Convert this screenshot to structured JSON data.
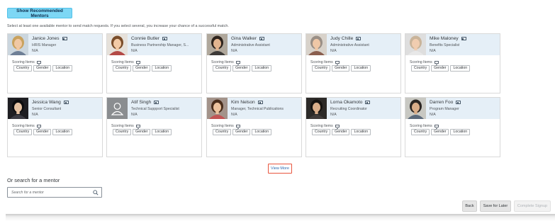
{
  "header": {
    "recommended_button": "Show Recommended Mentors",
    "instructions": "Select at least one available mentor to send match requests. If you select several, you increase your chance of a successful match."
  },
  "mentors": [
    {
      "name": "Janice Jones",
      "title": "HRIS Manager",
      "location": "N/A",
      "avatar": "photo-woman-blonde"
    },
    {
      "name": "Connie Butler",
      "title": "Business Partnership Manager, S...",
      "location": "N/A",
      "avatar": "photo-woman-smiling"
    },
    {
      "name": "Gina Walker",
      "title": "Administrative Assistant",
      "location": "N/A",
      "avatar": "photo-woman-dark-hair"
    },
    {
      "name": "Judy Chille",
      "title": "Administrative Assistant",
      "location": "N/A",
      "avatar": "photo-woman-gray-hair"
    },
    {
      "name": "Mike Maloney",
      "title": "Benefits Specialist",
      "location": "N/A",
      "avatar": "photo-man-bald"
    },
    {
      "name": "Jessica Wang",
      "title": "Senior Consultant",
      "location": "N/A",
      "avatar": "photo-woman-black-hair"
    },
    {
      "name": "Atif Singh",
      "title": "Technical Suppport Specialist",
      "location": "N/A",
      "avatar": "placeholder-person-icon"
    },
    {
      "name": "Kim Nelson",
      "title": "Manager, Technical Publications",
      "location": "N/A",
      "avatar": "photo-woman-brunette"
    },
    {
      "name": "Lorna Okamoto",
      "title": "Recruiting Coordinator",
      "location": "N/A",
      "avatar": "photo-woman-dark"
    },
    {
      "name": "Darren Foo",
      "title": "Program Manager",
      "location": "N/A",
      "avatar": "photo-man-dark-hair"
    }
  ],
  "scoring": {
    "label": "Scoring Items",
    "tags": [
      "Country",
      "Gender",
      "Location"
    ]
  },
  "view_more": "View More",
  "search": {
    "title": "Or search for a mentor",
    "placeholder": "Search for a mentor"
  },
  "footer": {
    "back": "Back",
    "save": "Save for Later",
    "complete": "Complete Signup"
  },
  "colors": {
    "accent_button": "#7dd7f5",
    "card_header": "#e5eff7",
    "focus_outline": "#e8553e",
    "link": "#2e6ab0"
  }
}
